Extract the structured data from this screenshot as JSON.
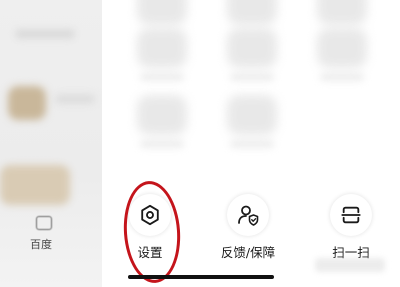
{
  "left_panel": {
    "label": "百度",
    "icon": "app-icon"
  },
  "bottom_menu": {
    "items": [
      {
        "label": "设置",
        "icon": "gear-hexagon-icon"
      },
      {
        "label": "反馈/保障",
        "icon": "user-shield-icon"
      },
      {
        "label": "扫一扫",
        "icon": "scan-icon"
      }
    ]
  },
  "colors": {
    "highlight_circle": "#c4141b",
    "background": "#ffffff",
    "text": "#1a1a1a"
  }
}
